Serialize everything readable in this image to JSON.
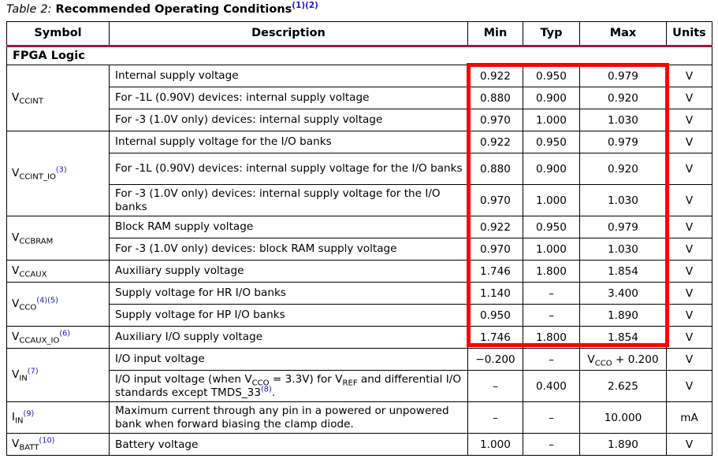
{
  "caption": {
    "label": "Table",
    "number": "2:",
    "title": "Recommended Operating Conditions",
    "footnotes": "(1)(2)"
  },
  "colors": {
    "header_rule": "#AB1243",
    "footnote": "#1a18d0",
    "highlight": "#FF0000",
    "grid": "#000000"
  },
  "table": {
    "headers": {
      "symbol": "Symbol",
      "description": "Description",
      "min": "Min",
      "typ": "Typ",
      "max": "Max",
      "units": "Units"
    },
    "section_label": "FPGA Logic",
    "rows": [
      {
        "symbol_html": "V<sub>CCINT</sub>",
        "symbol_text": "VCCINT",
        "symbol_rowspan": 3,
        "description": "Internal supply voltage",
        "min": "0.922",
        "typ": "0.950",
        "max": "0.979",
        "units": "V",
        "lines": 1
      },
      {
        "description": "For -1L (0.90V) devices: internal supply voltage",
        "min": "0.880",
        "typ": "0.900",
        "max": "0.920",
        "units": "V",
        "lines": 1
      },
      {
        "description": "For -3 (1.0V only) devices: internal supply voltage",
        "min": "0.970",
        "typ": "1.000",
        "max": "1.030",
        "units": "V",
        "lines": 1
      },
      {
        "symbol_html": "V<sub>CCINT_IO</sub><sup>(3)</sup>",
        "symbol_text": "VCCINT_IO(3)",
        "symbol_rowspan": 3,
        "description": "Internal supply voltage for the I/O banks",
        "min": "0.922",
        "typ": "0.950",
        "max": "0.979",
        "units": "V",
        "lines": 1
      },
      {
        "description": "For -1L (0.90V) devices: internal supply voltage for the I/O banks",
        "min": "0.880",
        "typ": "0.900",
        "max": "0.920",
        "units": "V",
        "lines": 2
      },
      {
        "description": "For -3 (1.0V only) devices: internal supply voltage for the I/O banks",
        "min": "0.970",
        "typ": "1.000",
        "max": "1.030",
        "units": "V",
        "lines": 2
      },
      {
        "symbol_html": "V<sub>CCBRAM</sub>",
        "symbol_text": "VCCBRAM",
        "symbol_rowspan": 2,
        "description": "Block RAM supply voltage",
        "min": "0.922",
        "typ": "0.950",
        "max": "0.979",
        "units": "V",
        "lines": 1
      },
      {
        "description": "For -3 (1.0V only) devices: block RAM supply voltage",
        "min": "0.970",
        "typ": "1.000",
        "max": "1.030",
        "units": "V",
        "lines": 1
      },
      {
        "symbol_html": "V<sub>CCAUX</sub>",
        "symbol_text": "VCCAUX",
        "symbol_rowspan": 1,
        "description": "Auxiliary supply voltage",
        "min": "1.746",
        "typ": "1.800",
        "max": "1.854",
        "units": "V",
        "lines": 1
      },
      {
        "symbol_html": "V<sub>CCO</sub><sup>(4)(5)</sup>",
        "symbol_text": "VCCO(4)(5)",
        "symbol_rowspan": 2,
        "description": "Supply voltage for HR I/O banks",
        "min": "1.140",
        "typ": "–",
        "max": "3.400",
        "units": "V",
        "lines": 1
      },
      {
        "description": "Supply voltage for HP I/O banks",
        "min": "0.950",
        "typ": "–",
        "max": "1.890",
        "units": "V",
        "lines": 1
      },
      {
        "symbol_html": "V<sub>CCAUX_IO</sub><sup>(6)</sup>",
        "symbol_text": "VCCAUX_IO(6)",
        "symbol_rowspan": 1,
        "description": "Auxiliary I/O supply voltage",
        "min": "1.746",
        "typ": "1.800",
        "max": "1.854",
        "units": "V",
        "lines": 1
      },
      {
        "symbol_html": "V<sub>IN</sub><sup>(7)</sup>",
        "symbol_text": "VIN(7)",
        "symbol_rowspan": 2,
        "description": "I/O input voltage",
        "min": "−0.200",
        "typ": "–",
        "max_html": "V<sub>CCO</sub> + 0.200",
        "max": "VCCO + 0.200",
        "units": "V",
        "lines": 1
      },
      {
        "description_html": "I/O input voltage (when V<sub>CCO</sub> = 3.3V) for V<sub>REF</sub> and differential I/O standards except TMDS_33<sup>(8)</sup>.",
        "description": "I/O input voltage (when VCCO = 3.3V) for VREF and differential I/O standards except TMDS_33(8).",
        "min": "–",
        "typ": "0.400",
        "max": "2.625",
        "units": "V",
        "lines": 2
      },
      {
        "symbol_html": "I<sub>IN</sub><sup>(9)</sup>",
        "symbol_text": "IIN(9)",
        "symbol_rowspan": 1,
        "description": "Maximum current through any pin in a powered or unpowered bank when forward biasing the clamp diode.",
        "min": "–",
        "typ": "–",
        "max": "10.000",
        "units": "mA",
        "lines": 2
      },
      {
        "symbol_html": "V<sub>BATT</sub><sup>(10)</sup>",
        "symbol_text": "VBATT(10)",
        "symbol_rowspan": 1,
        "description": "Battery voltage",
        "min": "1.000",
        "typ": "–",
        "max": "1.890",
        "units": "V",
        "lines": 1
      }
    ]
  },
  "annotation": {
    "type": "red-rectangle-highlight",
    "covers": "Min, Typ and Max columns from the VCCINT internal supply voltage row through the VCCAUX_IO auxiliary I/O supply voltage row"
  }
}
